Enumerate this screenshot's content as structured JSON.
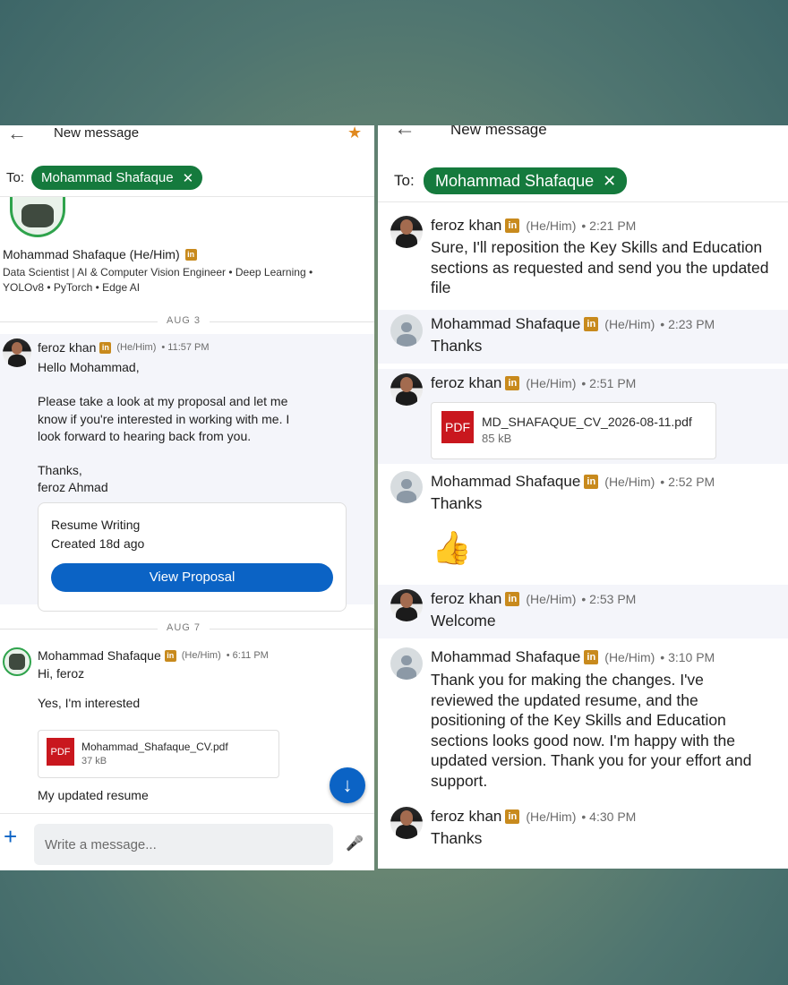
{
  "colors": {
    "accent": "#0b63c5",
    "chip_green": "#157a3d",
    "linkedin_badge": "#c88a1d",
    "pdf_red": "#c9171e",
    "star": "#e0891f"
  },
  "left": {
    "title": "New message",
    "to_label": "To:",
    "recipient": "Mohammad Shafaque",
    "chip_close": "✕",
    "profile": {
      "name": "Mohammad Shafaque (He/Him)",
      "headline": "Data Scientist | AI & Computer Vision Engineer • Deep Learning •",
      "headline2": "YOLOv8 • PyTorch • Edge AI"
    },
    "date1": "AUG 3",
    "msg1": {
      "name": "feroz khan",
      "pronouns": "(He/Him)",
      "time": "• 11:57 PM",
      "body": "Hello Mohammad,\n\nPlease take a look at my proposal and let me\nknow if you're interested in working with me. I\nlook forward to hearing back from you.\n\nThanks,\nferoz Ahmad"
    },
    "proposal": {
      "title": "Resume Writing",
      "created": "Created 18d ago",
      "button": "View Proposal"
    },
    "date2": "AUG 7",
    "msg2": {
      "name": "Mohammad Shafaque",
      "pronouns": "(He/Him)",
      "time": "• 6:11 PM",
      "line1": "Hi, feroz",
      "line2": "Yes, I'm interested",
      "file_name": "Mohammad_Shafaque_CV.pdf",
      "file_size": "37 kB",
      "line3": "My updated resume"
    },
    "compose_placeholder": "Write a message...",
    "icons": {
      "back": "←",
      "star": "★",
      "add": "+",
      "down": "↓",
      "mic": "🎤",
      "linkedin": "in",
      "pdf": "PDF"
    }
  },
  "right": {
    "title": "New message",
    "to_label": "To:",
    "recipient": "Mohammad Shafaque",
    "chip_close": "✕",
    "messages": [
      {
        "name": "feroz khan",
        "pronouns": "(He/Him)",
        "time": "•  2:21 PM",
        "body": "Sure, I'll reposition the Key Skills and Education\nsections as requested and send you the updated\nfile"
      },
      {
        "name": "Mohammad Shafaque",
        "pronouns": "(He/Him)",
        "time": "•  2:23 PM",
        "body": "Thanks"
      },
      {
        "name": "feroz khan",
        "pronouns": "(He/Him)",
        "time": "•  2:51 PM",
        "file_name": "MD_SHAFAQUE_CV_2026-08-11.pdf",
        "file_size": "85 kB"
      },
      {
        "name": "Mohammad Shafaque",
        "pronouns": "(He/Him)",
        "time": "•  2:52 PM",
        "body": "Thanks",
        "emoji": "👍"
      },
      {
        "name": "feroz khan",
        "pronouns": "(He/Him)",
        "time": "•  2:53 PM",
        "body": "Welcome"
      },
      {
        "name": "Mohammad Shafaque",
        "pronouns": "(He/Him)",
        "time": "•  3:10 PM",
        "body": "Thank you for making the changes. I've\nreviewed the updated resume, and the\npositioning of the Key Skills and Education\nsections looks good now. I'm happy with the\nupdated version. Thank you for your effort and\nsupport."
      },
      {
        "name": "feroz khan",
        "pronouns": "(He/Him)",
        "time": "•  4:30 PM",
        "body": "Thanks"
      }
    ]
  }
}
